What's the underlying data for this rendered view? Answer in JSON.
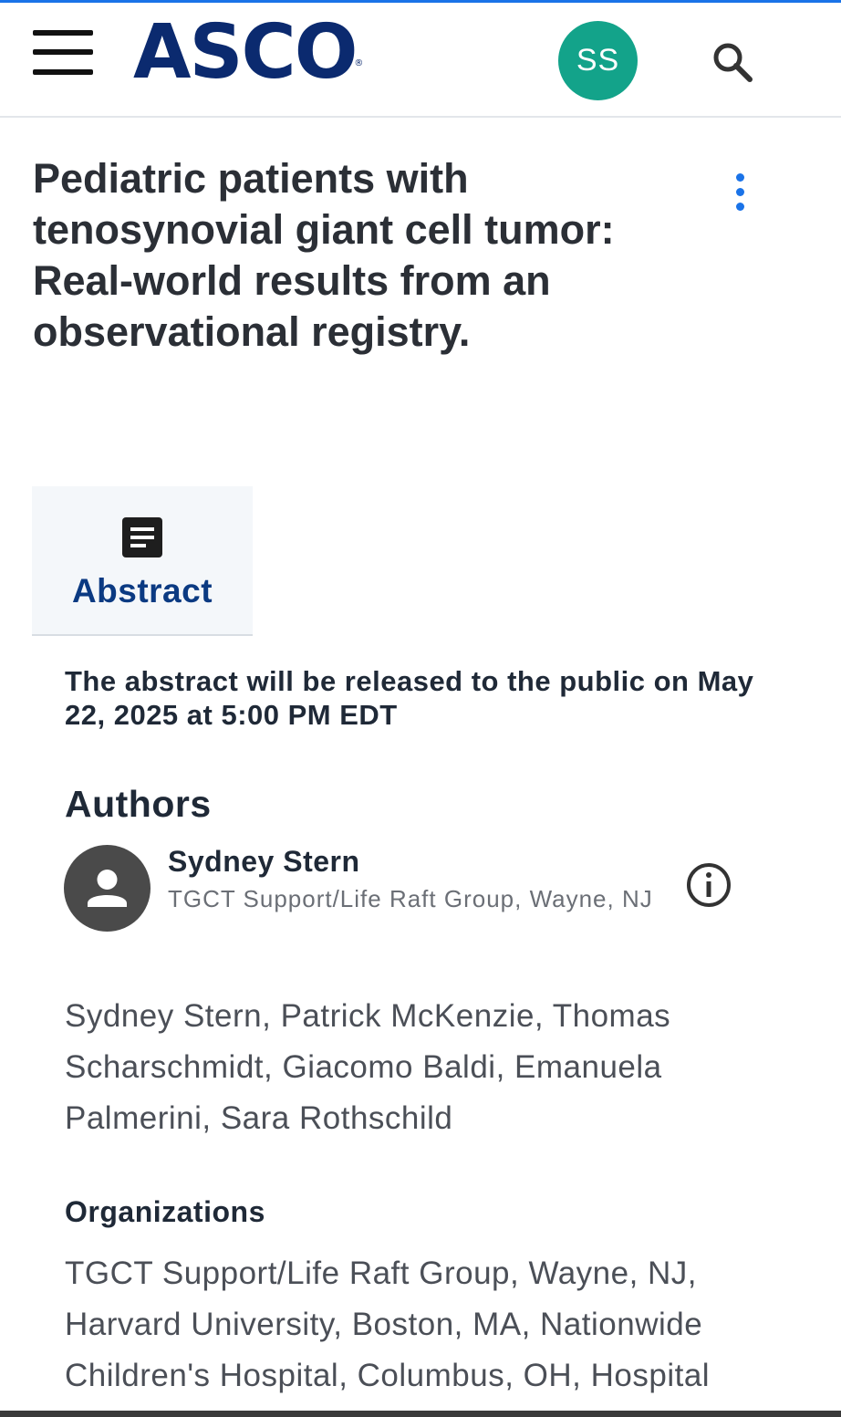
{
  "header": {
    "logo_text": "ASCO",
    "logo_mark": "®",
    "user_initials": "SS",
    "menu_icon": "hamburger-menu-icon",
    "search_icon": "search-icon",
    "colors": {
      "accent": "#1a73e8",
      "brand": "#0b2a6f",
      "avatar": "#13a38a"
    }
  },
  "article": {
    "title": "Pediatric patients with tenosynovial giant cell tumor: Real-world results from an observational registry.",
    "more_icon": "more-vertical-icon"
  },
  "tabs": [
    {
      "label": "Abstract",
      "icon": "document-icon",
      "selected": true
    }
  ],
  "release_notice": "The abstract will be released to the public on May 22, 2025 at 5:00 PM EDT",
  "authors": {
    "heading": "Authors",
    "presenter": {
      "name": "Sydney Stern",
      "affiliation": "TGCT Support/Life Raft Group, Wayne, NJ",
      "icon": "person-icon",
      "info_icon": "info-icon"
    },
    "list": "Sydney Stern, Patrick McKenzie, Thomas Scharschmidt, Giacomo Baldi, Emanuela Palmerini, Sara Rothschild"
  },
  "organizations": {
    "heading": "Organizations",
    "list": "TGCT Support/Life Raft Group, Wayne, NJ, Harvard University, Boston, MA, Nationwide Children's Hospital, Columbus, OH, Hospital"
  }
}
